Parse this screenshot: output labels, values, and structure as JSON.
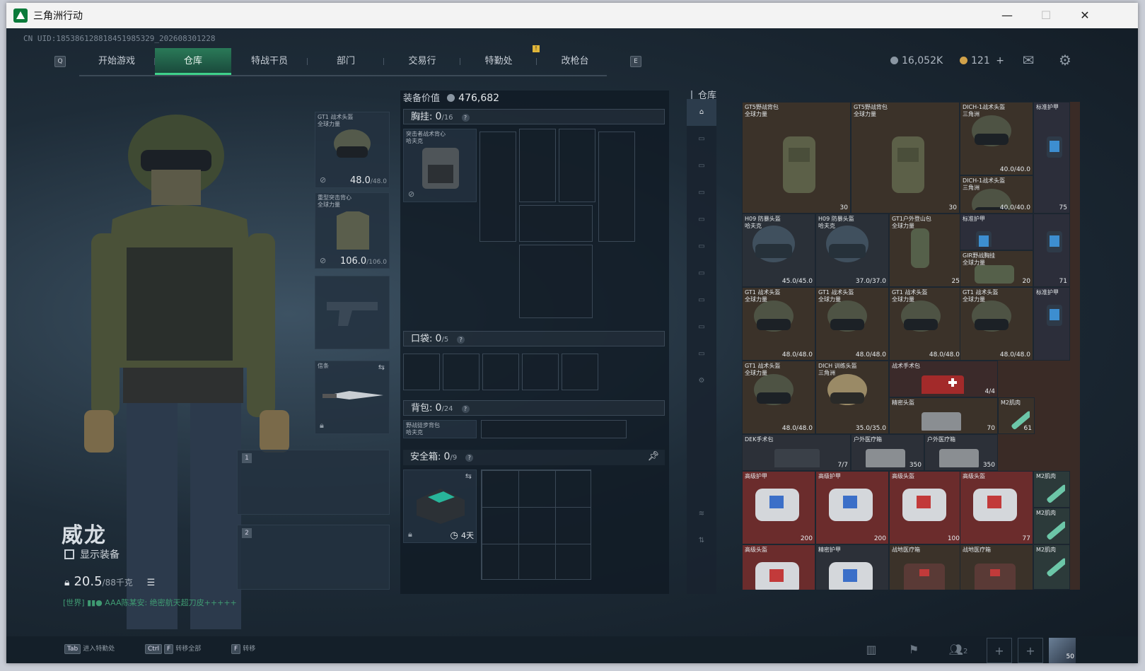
{
  "window": {
    "title": "三角洲行动",
    "minimize": "—",
    "maximize": "☐",
    "close": "✕"
  },
  "uid_text": "CN UID:18538612881845198532​9_202608301228",
  "nav": {
    "key_left": "Q",
    "key_right": "E",
    "tabs": [
      "开始游戏",
      "仓库",
      "特战干员",
      "部门",
      "交易行",
      "特勤处",
      "改枪台"
    ],
    "active_index": 1,
    "alert_badge": "!"
  },
  "currency": {
    "money": "16,052K",
    "coins": "121",
    "add": "+"
  },
  "operator": {
    "name": "威龙",
    "show_equipment": "显示装备",
    "weight_current": "20.5",
    "weight_max": "/88千克",
    "chat_line": "[世界] ▮▮● AAA陈某安: 绝密航天超刀皮+++++"
  },
  "slots": {
    "helmet": {
      "label": "GT1 战术头盔\n全球力量",
      "dur": "48.0",
      "dur_max": "/48.0"
    },
    "armor": {
      "label": "重型突击背心\n全球力量",
      "dur": "106.0",
      "dur_max": "/106.0"
    },
    "melee": {
      "label": "信条"
    },
    "weapon1_num": "1",
    "weapon2_num": "2"
  },
  "equipment": {
    "value_label": "装备价值",
    "value": "476,682",
    "chest_label": "胸挂:",
    "chest_value": "0",
    "chest_max": "/16",
    "chest_item": "突击者战术背心\n哈夫克",
    "pocket_label": "口袋:",
    "pocket_value": "0",
    "pocket_max": "/5",
    "backpack_label": "背包:",
    "backpack_value": "0",
    "backpack_max": "/24",
    "backpack_item": "野战徒步背包\n哈夫克",
    "safe_label": "安全箱:",
    "safe_value": "0",
    "safe_max": "/9",
    "safe_timer": "4天",
    "help": "?"
  },
  "warehouse": {
    "title": "仓库",
    "items": [
      {
        "name": "GT5野战背包\n全球力量",
        "val": "30"
      },
      {
        "name": "GT5野战背包\n全球力量",
        "val": "30"
      },
      {
        "name": "DICH-1战术头盔\n三角洲",
        "val": "40.0/40.0"
      },
      {
        "name": "标准护甲",
        "val": "75"
      },
      {
        "name": "DICH-1战术头盔\n三角洲",
        "val": "40.0/40.0"
      },
      {
        "name": "H09 防暴头盔\n哈夫克",
        "val": "45.0/45.0"
      },
      {
        "name": "H09 防暴头盔\n哈夫克",
        "val": "37.0/37.0"
      },
      {
        "name": "GT1户外登山包\n全球力量",
        "val": "25"
      },
      {
        "name": "标准护甲",
        "val": ""
      },
      {
        "name": "GIR野战胸挂\n全球力量",
        "val": "20"
      },
      {
        "name": "",
        "val": "71"
      },
      {
        "name": "GT1 战术头盔\n全球力量",
        "val": "48.0/48.0"
      },
      {
        "name": "GT1 战术头盔\n全球力量",
        "val": "48.0/48.0"
      },
      {
        "name": "GT1 战术头盔\n全球力量",
        "val": "48.0/48.0"
      },
      {
        "name": "GT1 战术头盔\n全球力量",
        "val": "48.0/48.0"
      },
      {
        "name": "标准护甲",
        "val": ""
      },
      {
        "name": "GT1 战术头盔\n全球力量",
        "val": "48.0/48.0"
      },
      {
        "name": "DICH 训练头盔\n三角洲",
        "val": "35.0/35.0"
      },
      {
        "name": "战术手术包",
        "val": "4/4"
      },
      {
        "name": "精密头盔",
        "val": "70"
      },
      {
        "name": "M2肌肉",
        "val": "61"
      },
      {
        "name": "DEK手术包",
        "val": "7/7"
      },
      {
        "name": "户外医疗箱",
        "val": "350"
      },
      {
        "name": "户外医疗箱",
        "val": "350"
      },
      {
        "name": "高级护甲",
        "val": "200"
      },
      {
        "name": "高级护甲",
        "val": "200"
      },
      {
        "name": "高级头盔",
        "val": "100"
      },
      {
        "name": "高级头盔",
        "val": "77"
      },
      {
        "name": "M2肌肉",
        "val": ""
      },
      {
        "name": "M2肌肉",
        "val": ""
      },
      {
        "name": "高级头盔",
        "val": ""
      },
      {
        "name": "精密护甲",
        "val": ""
      },
      {
        "name": "战地医疗箱",
        "val": ""
      },
      {
        "name": "战地医疗箱",
        "val": ""
      },
      {
        "name": "M2肌肉",
        "val": ""
      }
    ]
  },
  "bottom": {
    "hint1_key": "Tab",
    "hint1": "进入特勤处",
    "hint2_key1": "Ctrl",
    "hint2_key2": "F",
    "hint2": "转移全部",
    "hint3_key": "F",
    "hint3": "转移",
    "squad_count": "2",
    "level": "50"
  },
  "colors": {
    "accent": "#3fd18b",
    "grid_bg": "#3a2b26",
    "rare_red": "#6b2c2c"
  }
}
